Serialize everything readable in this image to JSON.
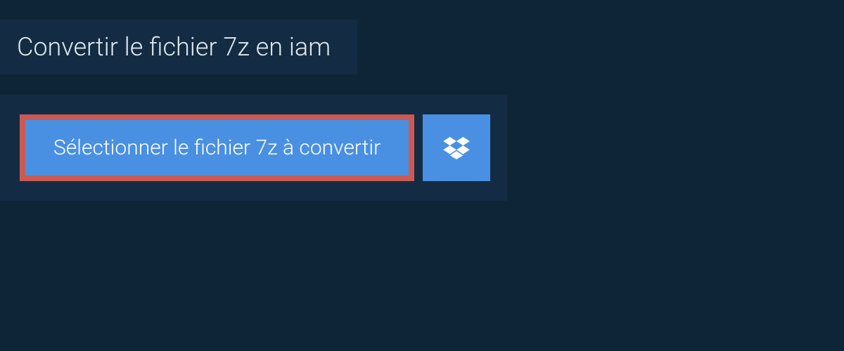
{
  "title": "Convertir le fichier 7z en iam",
  "selectButton": {
    "label": "Sélectionner le fichier 7z à convertir"
  }
}
